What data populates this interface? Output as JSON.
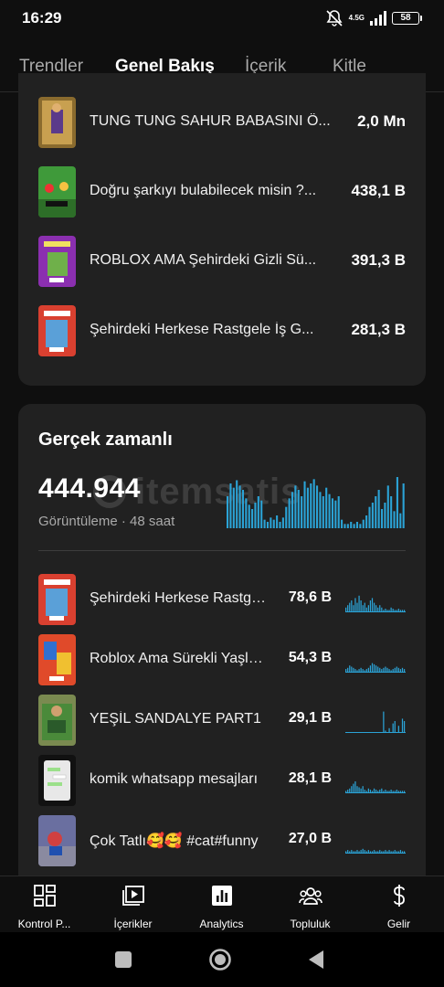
{
  "status": {
    "time": "16:29",
    "network": "4.5G",
    "battery": "58"
  },
  "tabs": [
    "Trendler",
    "Genel Bakış",
    "İçerik",
    "Kitle"
  ],
  "top_videos": [
    {
      "title": "TUNG TUNG SAHUR BABASINI Ö...",
      "views": "2,0 Mn",
      "thumb": "thumb-runner"
    },
    {
      "title": "Doğru şarkıyı bulabilecek misin ?...",
      "views": "438,1 B",
      "thumb": "thumb-green"
    },
    {
      "title": "ROBLOX AMA Şehirdeki Gizli Sü...",
      "views": "391,3 B",
      "thumb": "thumb-purple"
    },
    {
      "title": "Şehirdeki Herkese Rastgele İş G...",
      "views": "281,3 B",
      "thumb": "thumb-red"
    }
  ],
  "realtime": {
    "title": "Gerçek zamanlı",
    "total": "444.944",
    "subtitle": "Görüntüleme · 48 saat",
    "watermark": "itemsatis",
    "chart_color": "#2ba3d6",
    "bars": [
      30,
      42,
      38,
      45,
      40,
      36,
      28,
      22,
      18,
      24,
      30,
      26,
      8,
      6,
      10,
      8,
      12,
      6,
      10,
      20,
      28,
      34,
      40,
      36,
      30,
      44,
      38,
      42,
      46,
      40,
      34,
      30,
      38,
      32,
      28,
      26,
      30,
      8,
      4,
      4,
      6,
      4,
      6,
      4,
      8,
      12,
      20,
      24,
      30,
      36,
      18,
      24,
      40,
      30,
      16,
      48,
      14,
      42
    ],
    "videos": [
      {
        "title": "Şehirdeki Herkese Rastgele İş Gücü",
        "views": "78,6 B",
        "thumb": "thumb-red",
        "spark": [
          4,
          6,
          8,
          10,
          6,
          12,
          8,
          14,
          10,
          6,
          8,
          4,
          6,
          10,
          12,
          8,
          6,
          4,
          6,
          4,
          2,
          3,
          2,
          2,
          4,
          3,
          2,
          2,
          3,
          2,
          2,
          2
        ]
      },
      {
        "title": "Roblox Ama Sürekli Yaşlanıyorum",
        "views": "54,3 B",
        "thumb": "thumb-lego",
        "spark": [
          3,
          4,
          6,
          5,
          4,
          3,
          2,
          3,
          4,
          3,
          2,
          3,
          4,
          6,
          8,
          7,
          6,
          5,
          4,
          3,
          4,
          5,
          4,
          3,
          2,
          3,
          4,
          5,
          4,
          3,
          4,
          3
        ]
      },
      {
        "title": "YEŞİL SANDALYE PART1",
        "views": "29,1 B",
        "thumb": "thumb-chair",
        "spark": [
          0,
          0,
          0,
          0,
          0,
          0,
          0,
          0,
          0,
          0,
          0,
          0,
          0,
          0,
          0,
          0,
          0,
          0,
          0,
          0,
          18,
          2,
          0,
          4,
          0,
          8,
          10,
          0,
          6,
          0,
          12,
          10
        ]
      },
      {
        "title": "komik whatsapp mesajları",
        "views": "28,1 B",
        "thumb": "thumb-phone",
        "spark": [
          2,
          3,
          4,
          6,
          8,
          10,
          6,
          5,
          4,
          6,
          3,
          2,
          4,
          3,
          2,
          4,
          3,
          2,
          3,
          4,
          2,
          3,
          2,
          2,
          3,
          2,
          2,
          3,
          2,
          2,
          2,
          2
        ]
      },
      {
        "title": "Çok Tatlı🥰🥰  #cat#funny",
        "views": "27,0 B",
        "thumb": "thumb-cat",
        "spark": [
          2,
          3,
          2,
          3,
          2,
          2,
          3,
          2,
          3,
          4,
          3,
          2,
          3,
          2,
          2,
          3,
          2,
          2,
          3,
          2,
          2,
          3,
          2,
          3,
          2,
          2,
          3,
          2,
          2,
          3,
          2,
          2
        ]
      }
    ]
  },
  "bottom_nav": [
    {
      "label": "Kontrol P...",
      "icon": "dashboard-icon"
    },
    {
      "label": "İçerikler",
      "icon": "content-icon"
    },
    {
      "label": "Analytics",
      "icon": "analytics-icon"
    },
    {
      "label": "Topluluk",
      "icon": "community-icon"
    },
    {
      "label": "Gelir",
      "icon": "earn-icon"
    }
  ]
}
